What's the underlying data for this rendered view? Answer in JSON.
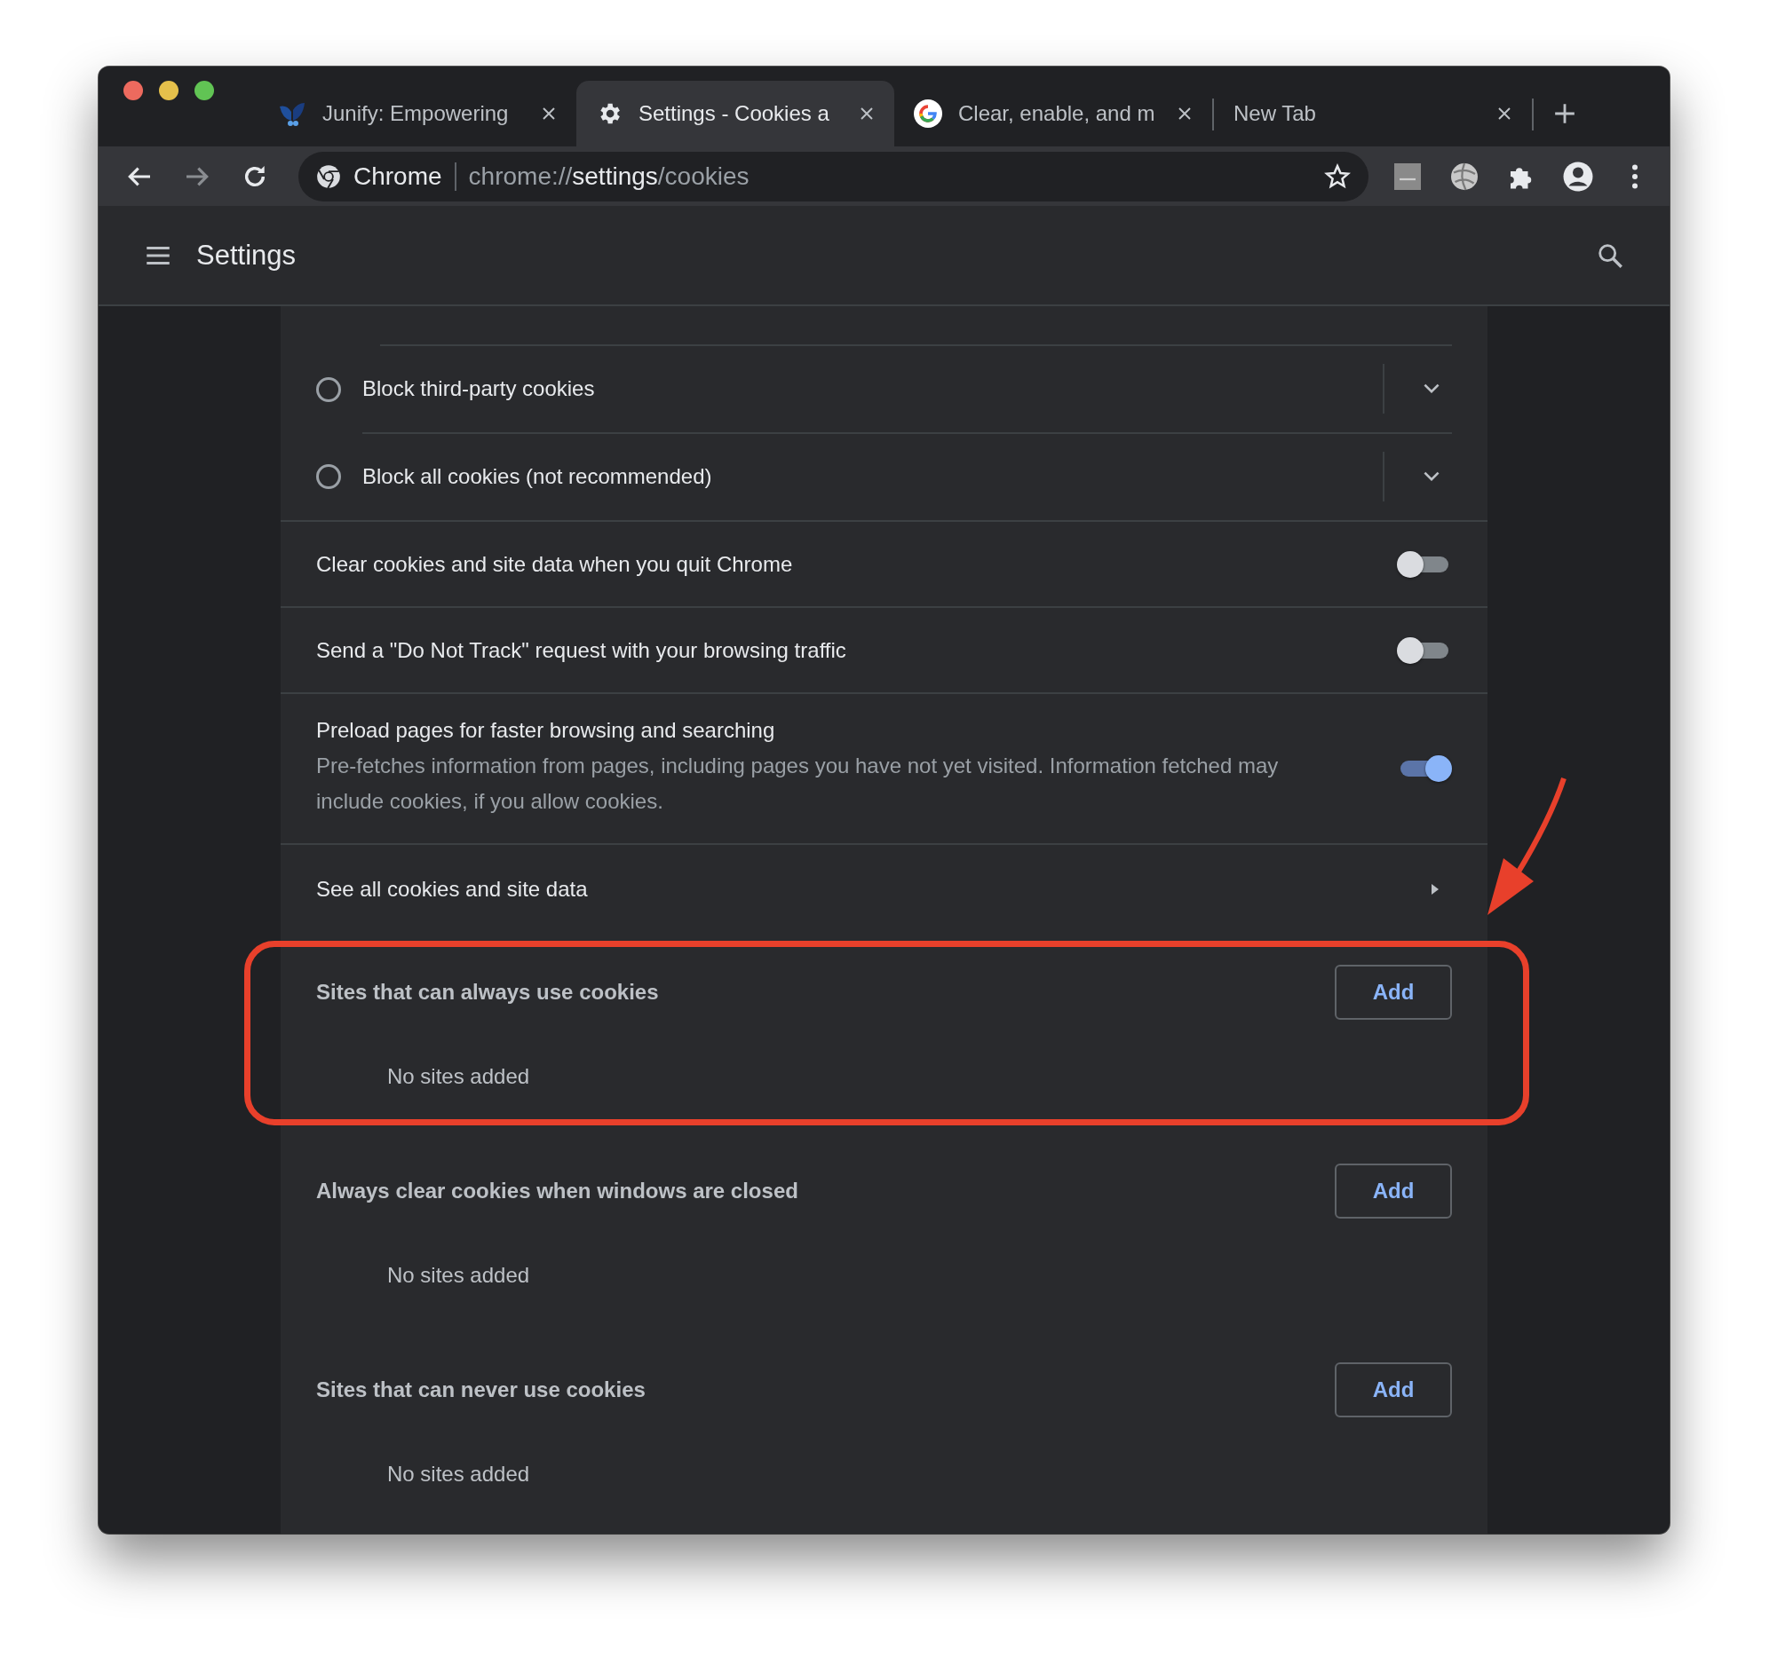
{
  "tabs": [
    {
      "title": "Junify: Empowering",
      "kind": "junify",
      "selected": false
    },
    {
      "title": "Settings - Cookies a",
      "kind": "settings",
      "selected": true
    },
    {
      "title": "Clear, enable, and m",
      "kind": "google",
      "selected": false
    },
    {
      "title": "New Tab",
      "kind": "blank",
      "selected": false
    }
  ],
  "address_bar": {
    "site_label": "Chrome",
    "url_scheme": "chrome://",
    "url_host": "settings",
    "url_path": "/cookies"
  },
  "header": {
    "title": "Settings"
  },
  "cookie_options": [
    {
      "label": "Block third-party cookies",
      "selected": false
    },
    {
      "label": "Block all cookies (not recommended)",
      "selected": false
    }
  ],
  "toggles": [
    {
      "label": "Clear cookies and site data when you quit Chrome",
      "on": false
    },
    {
      "label": "Send a \"Do Not Track\" request with your browsing traffic",
      "on": false
    },
    {
      "label": "Preload pages for faster browsing and searching",
      "description": "Pre-fetches information from pages, including pages you have not yet visited. Information fetched may include cookies, if you allow cookies.",
      "on": true
    }
  ],
  "link_row": {
    "label": "See all cookies and site data"
  },
  "site_lists": [
    {
      "title": "Sites that can always use cookies",
      "button": "Add",
      "empty": "No sites added",
      "highlighted": true
    },
    {
      "title": "Always clear cookies when windows are closed",
      "button": "Add",
      "empty": "No sites added",
      "highlighted": false
    },
    {
      "title": "Sites that can never use cookies",
      "button": "Add",
      "empty": "No sites added",
      "highlighted": false
    }
  ],
  "annotation": {
    "arrow": true
  }
}
